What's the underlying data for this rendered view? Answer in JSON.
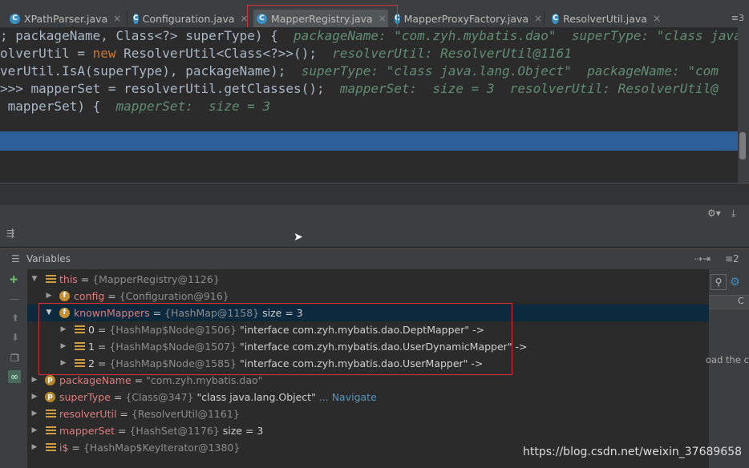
{
  "tabs": [
    {
      "label": "XPathParser.java",
      "close": "×"
    },
    {
      "label": "Configuration.java",
      "close": "×"
    },
    {
      "label": "MapperRegistry.java",
      "close": "×"
    },
    {
      "label": "MapperProxyFactory.java",
      "close": "×"
    },
    {
      "label": "ResolverUtil.java",
      "close": "×"
    }
  ],
  "tab_icon_letter": "C",
  "tabs_more": "≡3",
  "code": {
    "line1": {
      "code": "; packageName, Class<?> superType) {  ",
      "hint": "packageName: \"com.zyh.mybatis.dao\"  superType: \"class java"
    },
    "line2": {
      "code_a": "olverUtil = ",
      "kw": "new",
      "code_b": " ResolverUtil<Class<?>>();  ",
      "hint": "resolverUtil: ResolverUtil@1161"
    },
    "line3": {
      "code": "verUtil.IsA(superType), packageName);  ",
      "hint": "superType: \"class java.lang.Object\"  packageName: \"com"
    },
    "line4": {
      "code": ">>> mapperSet = resolverUtil.getClasses();  ",
      "hint": "mapperSet:  size = 3  resolverUtil: ResolverUtil@"
    },
    "line5": {
      "code": " mapperSet) {  ",
      "hint": "mapperSet:  size = 3"
    }
  },
  "panel": {
    "title": "Variables",
    "right_label": "≡2"
  },
  "variables": [
    {
      "name": "this",
      "ref": "{MapperRegistry@1126}"
    },
    {
      "name": "config",
      "ref": "{Configuration@916}"
    },
    {
      "name": "knownMappers",
      "ref": "{HashMap@1158}",
      "extra": "size = 3"
    },
    {
      "name": "0",
      "ref": "{HashMap$Node@1506}",
      "value": "\"interface com.zyh.mybatis.dao.DeptMapper\" ->"
    },
    {
      "name": "1",
      "ref": "{HashMap$Node@1507}",
      "value": "\"interface com.zyh.mybatis.dao.UserDynamicMapper\" ->"
    },
    {
      "name": "2",
      "ref": "{HashMap$Node@1585}",
      "value": "\"interface com.zyh.mybatis.dao.UserMapper\" ->"
    },
    {
      "name": "packageName",
      "ref": "\"com.zyh.mybatis.dao\""
    },
    {
      "name": "superType",
      "ref": "{Class@347}",
      "value": "\"class java.lang.Object\"",
      "nav": "... Navigate"
    },
    {
      "name": "resolverUtil",
      "ref": "{ResolverUtil@1161}"
    },
    {
      "name": "mapperSet",
      "ref": "{HashSet@1176}",
      "extra": "size = 3"
    },
    {
      "name": "i$",
      "ref": "{HashMap$KeyIterator@1380}"
    }
  ],
  "right_panel": {
    "col_label": "C",
    "fragment": "oad the c"
  },
  "watermark": "https://blog.csdn.net/weixin_37689658"
}
